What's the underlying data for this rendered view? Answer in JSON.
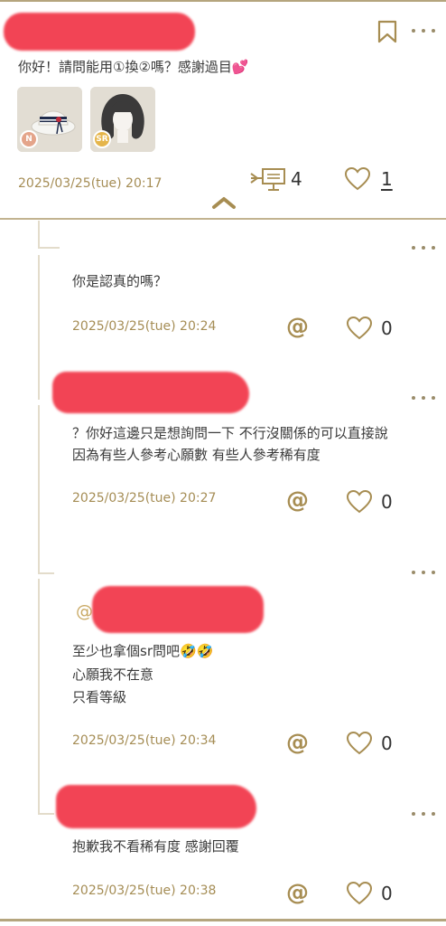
{
  "post": {
    "text": "你好！請問能用①換②嗎？感謝過目💕",
    "items": [
      {
        "rarity": "N",
        "rarity_color": "#e4a48a",
        "name": "hat-item"
      },
      {
        "rarity": "SR",
        "rarity_color": "#e5b54a",
        "name": "hair-item"
      }
    ],
    "date": "2025/03/25(tue) 20:17",
    "reply_count": "4",
    "like_count": "1"
  },
  "comments": [
    {
      "text": [
        "你是認真的嗎？"
      ],
      "date": "2025/03/25(tue) 20:24",
      "likes": "0"
    },
    {
      "text": [
        "？你好這邊只是想詢問一下 不行沒關係的可以直接說",
        "因為有些人參考心願數 有些人參考稀有度"
      ],
      "date": "2025/03/25(tue) 20:27",
      "likes": "0"
    },
    {
      "mention": "@",
      "text": [
        "至少也拿個sr問吧🤣🤣",
        "心願我不在意",
        "只看等級"
      ],
      "date": "2025/03/25(tue) 20:34",
      "likes": "0"
    },
    {
      "text": [
        "抱歉我不看稀有度 感謝回覆"
      ],
      "date": "2025/03/25(tue) 20:38",
      "likes": "0"
    }
  ],
  "icons": {
    "bookmark": "bookmark-icon",
    "more": "more-dots-icon",
    "reply": "reply-board-icon",
    "heart": "heart-icon",
    "mention": "at-icon",
    "collapse": "chevron-up-icon"
  },
  "colors": {
    "accent": "#a78d52",
    "redaction": "#f23b4c",
    "divider": "#c2b390"
  }
}
